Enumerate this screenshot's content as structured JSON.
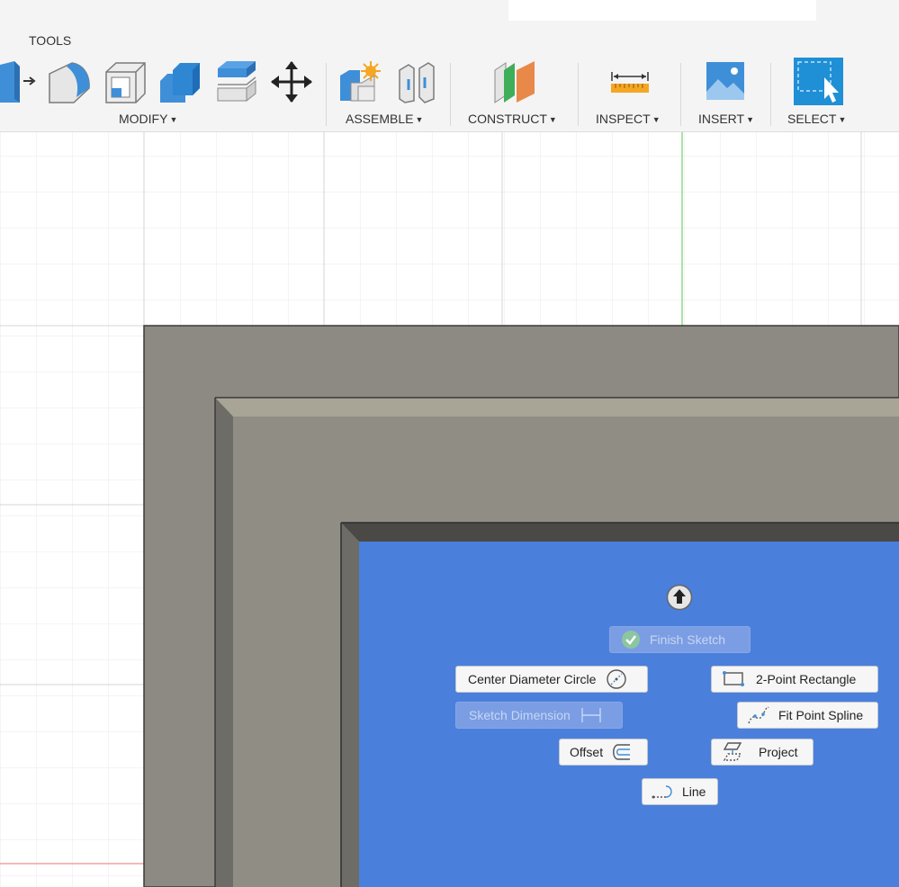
{
  "toolbar": {
    "tab": "TOOLS",
    "groups": {
      "modify": "MODIFY",
      "assemble": "ASSEMBLE",
      "construct": "CONSTRUCT",
      "inspect": "INSPECT",
      "insert": "INSERT",
      "select": "SELECT"
    }
  },
  "marking_menu": {
    "finish_sketch": "Finish Sketch",
    "center_diameter_circle": "Center Diameter Circle",
    "two_point_rectangle": "2-Point Rectangle",
    "sketch_dimension": "Sketch Dimension",
    "fit_point_spline": "Fit Point Spline",
    "offset": "Offset",
    "project": "Project",
    "line": "Line"
  },
  "colors": {
    "toolbar_bg": "#f4f4f4",
    "sketch_face": "#4a7fdc",
    "body_gray": "#8c8a82",
    "select_blue": "#1f8fd6"
  }
}
